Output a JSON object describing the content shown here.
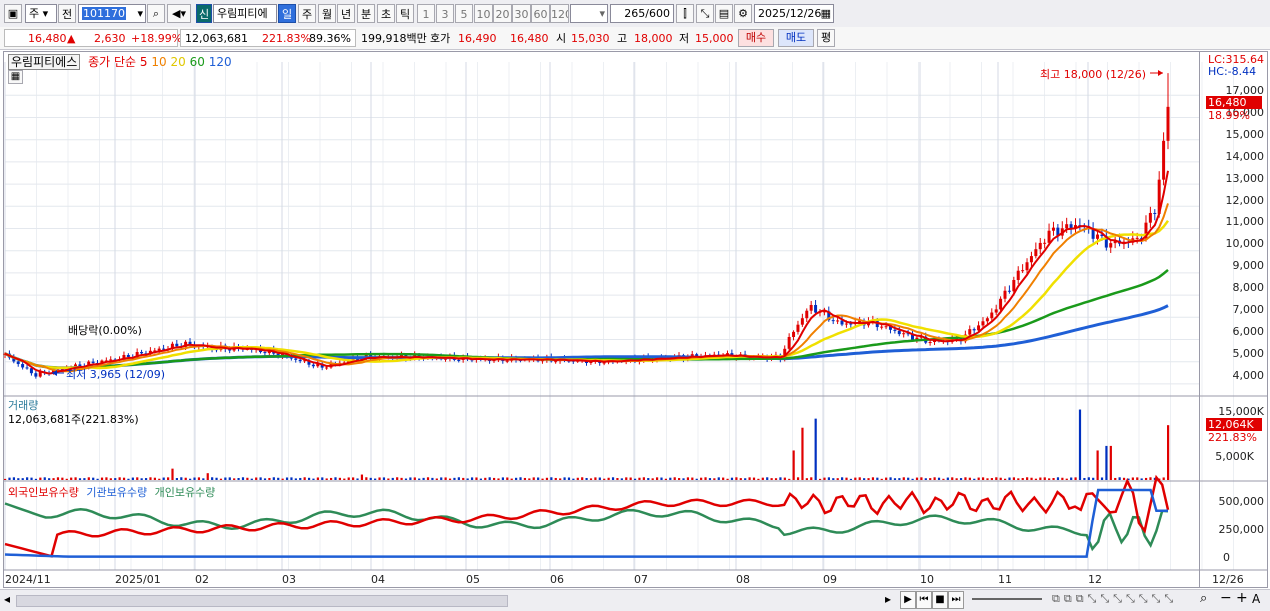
{
  "toolbar": {
    "type": "주",
    "prev_label": "전",
    "code": "101170",
    "search_icon": "search-icon",
    "new_label": "신",
    "stock_name": "우림피티에",
    "periods": [
      "일",
      "주",
      "월",
      "년",
      "분",
      "초",
      "틱"
    ],
    "selected_period": "일",
    "minutes": [
      "1",
      "3",
      "5",
      "10",
      "20",
      "30",
      "60",
      "120"
    ],
    "count": "265",
    "count_total": "/600",
    "date": "2025/12/26"
  },
  "quote": {
    "price": "16,480",
    "change": "2,630",
    "change_pct": "+18.99%",
    "volume": "12,063,681",
    "volume_pct": "221.83%",
    "turnover": "89.36%",
    "amount": "199,918백만",
    "bid_label": "호가",
    "bid": "16,490",
    "ask": "16,480",
    "open_label": "시",
    "open": "15,030",
    "high_label": "고",
    "high": "18,000",
    "low_label": "저",
    "low": "15,000",
    "buy_label": "매수",
    "sell_label": "매도",
    "eval_label": "평"
  },
  "price_panel": {
    "stock_name": "우림피티에스",
    "ma_label": "종가 단순",
    "ma_periods": [
      "5",
      "10",
      "20",
      "60",
      "120"
    ],
    "dividend_note": "배당락(0.00%)",
    "low_note": "최저 3,965 (12/09)",
    "high_note": "최고 18,000 (12/26)",
    "lc": "LC:315.64",
    "hc": "HC:-8.44",
    "last_price": "16,480",
    "last_pct": "18.99%",
    "y_ticks": [
      "17,000",
      "16,000",
      "15,000",
      "14,000",
      "13,000",
      "12,000",
      "11,000",
      "10,000",
      "9,000",
      "8,000",
      "7,000",
      "6,000",
      "5,000",
      "4,000"
    ]
  },
  "volume_panel": {
    "title": "거래량",
    "value": "12,063,681주(221.83%)",
    "y_ticks": [
      "15,000K",
      "5,000K"
    ],
    "last_tag": "12,064K",
    "last_pct": "221.83%"
  },
  "holder_panel": {
    "legend": [
      "외국인보유수량",
      "기관보유수량",
      "개인보유수량"
    ],
    "y_ticks": [
      "500,000",
      "250,000",
      "0"
    ]
  },
  "x_axis": [
    "2024/11",
    "2025/01",
    "02",
    "03",
    "04",
    "05",
    "06",
    "07",
    "08",
    "09",
    "10",
    "11",
    "12",
    "12/26"
  ],
  "chart_data": {
    "type": "candlestick",
    "title": "우림피티에스",
    "price_ylim": [
      3500,
      18500
    ],
    "price_path": [
      [
        0,
        5300
      ],
      [
        0.5,
        4400
      ],
      [
        1,
        4700
      ],
      [
        1.6,
        5000
      ],
      [
        2,
        5200
      ],
      [
        2.5,
        5500
      ],
      [
        3,
        5800
      ],
      [
        3.5,
        5600
      ],
      [
        4,
        5600
      ],
      [
        4.5,
        5400
      ],
      [
        5,
        5000
      ],
      [
        5.3,
        4750
      ],
      [
        5.7,
        5000
      ],
      [
        6,
        5200
      ],
      [
        7,
        5200
      ],
      [
        8,
        5100
      ],
      [
        9,
        5100
      ],
      [
        10,
        5000
      ],
      [
        11,
        5150
      ],
      [
        12,
        5300
      ],
      [
        12.5,
        5200
      ],
      [
        13,
        5200
      ],
      [
        13.2,
        6300
      ],
      [
        13.5,
        7500
      ],
      [
        14,
        6700
      ],
      [
        14.5,
        6800
      ],
      [
        15,
        6300
      ],
      [
        15.5,
        5900
      ],
      [
        16,
        6000
      ],
      [
        16.5,
        7000
      ],
      [
        17,
        9000
      ],
      [
        17.5,
        10800
      ],
      [
        18,
        11200
      ],
      [
        18.5,
        10300
      ],
      [
        19,
        10500
      ],
      [
        19.3,
        12000
      ],
      [
        19.5,
        16480
      ]
    ],
    "last": {
      "price": 16480,
      "high": 18000,
      "low_period": 3965
    },
    "volume_spikes_k": [
      [
        2.8,
        2500
      ],
      [
        3.4,
        1500
      ],
      [
        6.0,
        1200
      ],
      [
        13.2,
        6500
      ],
      [
        13.4,
        11500
      ],
      [
        13.6,
        13500
      ],
      [
        18.0,
        15500
      ],
      [
        18.3,
        6500
      ],
      [
        18.5,
        7500
      ],
      [
        19.5,
        12064
      ]
    ],
    "holders": {
      "foreign": "red",
      "institution": "blue",
      "individual": "green"
    }
  },
  "bottom": {
    "nav_icons": [
      "play-icon",
      "rewind-icon",
      "stop-icon",
      "fast-forward-icon"
    ],
    "zoom_out": "−",
    "zoom_in": "+",
    "a_label": "A"
  },
  "colors": {
    "up": "#e00000",
    "down": "#0030c0",
    "ma5": "#e00000",
    "ma10": "#f08000",
    "ma20": "#f0e000",
    "ma60": "#1a9a1a",
    "ma120": "#1f5fd6",
    "foreign": "#e00000",
    "institution": "#1f5fd6",
    "individual": "#2e8b57"
  }
}
